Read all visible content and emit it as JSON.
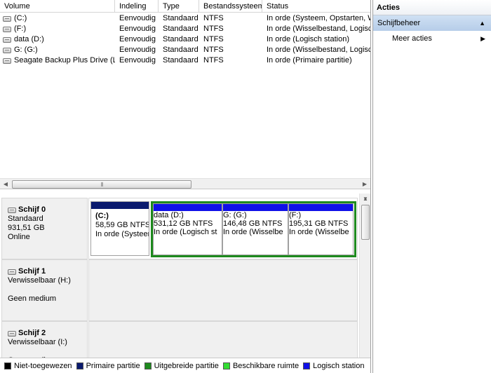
{
  "volume_list": {
    "columns": [
      "Volume",
      "Indeling",
      "Type",
      "Bestandssysteem",
      "Status"
    ],
    "rows": [
      {
        "volume": "(C:)",
        "indeling": "Eenvoudig",
        "type": "Standaard",
        "fs": "NTFS",
        "status": "In orde (Systeem, Opstarten, W"
      },
      {
        "volume": "(F:)",
        "indeling": "Eenvoudig",
        "type": "Standaard",
        "fs": "NTFS",
        "status": "In orde (Wisselbestand, Logisch"
      },
      {
        "volume": "data (D:)",
        "indeling": "Eenvoudig",
        "type": "Standaard",
        "fs": "NTFS",
        "status": "In orde (Logisch station)"
      },
      {
        "volume": "G: (G:)",
        "indeling": "Eenvoudig",
        "type": "Standaard",
        "fs": "NTFS",
        "status": "In orde (Wisselbestand, Logisch"
      },
      {
        "volume": "Seagate Backup Plus Drive (L:)",
        "indeling": "Eenvoudig",
        "type": "Standaard",
        "fs": "NTFS",
        "status": "In orde (Primaire partitie)"
      }
    ],
    "hscroll_grip": "⦀"
  },
  "disks": {
    "disk0": {
      "name": "Schijf 0",
      "type": "Standaard",
      "size": "931,51 GB",
      "state": "Online",
      "partitions": {
        "c": {
          "name": "(C:)",
          "size": "58,59 GB NTFS",
          "status": "In orde (Systeer"
        },
        "d": {
          "name": "data  (D:)",
          "size": "531,12 GB NTFS",
          "status": "In orde (Logisch st"
        },
        "g": {
          "name": "G:  (G:)",
          "size": "146,48 GB NTFS",
          "status": "In orde (Wisselbe"
        },
        "f": {
          "name": "(F:)",
          "size": "195,31 GB NTFS",
          "status": "In orde (Wisselbe"
        }
      }
    },
    "disk1": {
      "name": "Schijf 1",
      "type": "Verwisselbaar (H:)",
      "state": "Geen medium"
    },
    "disk2": {
      "name": "Schijf 2",
      "type": "Verwisselbaar (I:)",
      "state": "Geen medium"
    }
  },
  "legend": [
    {
      "label": "Niet-toegewezen",
      "color": "#000000"
    },
    {
      "label": "Primaire partitie",
      "color": "#0a1a6e"
    },
    {
      "label": "Uitgebreide partitie",
      "color": "#1e8a1e"
    },
    {
      "label": "Beschikbare ruimte",
      "color": "#33dd33"
    },
    {
      "label": "Logisch station",
      "color": "#1010e8"
    }
  ],
  "actions": {
    "title": "Acties",
    "group_label": "Schijfbeheer",
    "group_caret": "▲",
    "more_label": "Meer acties",
    "more_caret": "▶"
  },
  "scroll_glyphs": {
    "left": "◀",
    "right": "▶",
    "up": "▲",
    "down": "▼"
  },
  "colors": {
    "primary_partition": "#0a1a6e",
    "logical_drive": "#1010e8",
    "extended_partition": "#1e8a1e",
    "action_group_bg": "#b6cde9"
  }
}
